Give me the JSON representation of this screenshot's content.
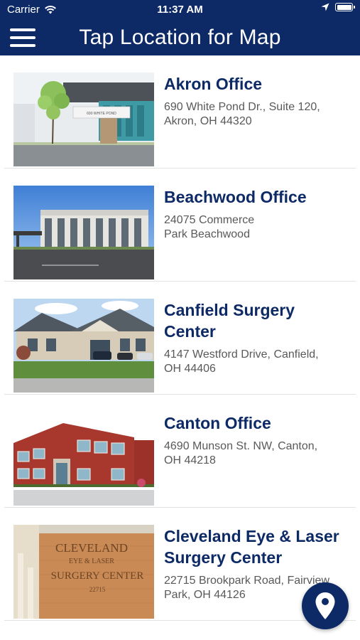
{
  "status_bar": {
    "carrier": "Carrier",
    "time": "11:37 AM",
    "icons": [
      "wifi-icon",
      "location-arrow-icon",
      "battery-icon"
    ]
  },
  "nav_bar": {
    "title": "Tap Location for Map",
    "menu_icon": "hamburger-menu-icon"
  },
  "locations": [
    {
      "name": "Akron Office",
      "address_line1": "690 White Pond Dr., Suite 120,",
      "address_line2": "Akron, OH 44320",
      "photo_sign": "690 WHITE POND"
    },
    {
      "name": "Beachwood Office",
      "address_line1": "24075 Commerce",
      "address_line2": "Park Beachwood"
    },
    {
      "name": "Canfield Surgery Center",
      "address_line1": "4147 Westford Drive, Canfield,",
      "address_line2": "OH 44406"
    },
    {
      "name": "Canton Office",
      "address_line1": "4690 Munson St. NW, Canton,",
      "address_line2": "OH 44218"
    },
    {
      "name": "Cleveland Eye & Laser Surgery Center",
      "address_line1": "22715 Brookpark Road, Fairview",
      "address_line2": "Park, OH 44126",
      "photo_sign_lines": [
        "CLEVELAND",
        "EYE & LASER",
        "SURGERY CENTER",
        "22715"
      ]
    }
  ],
  "map_button": {
    "icon": "map-pin-icon"
  },
  "colors": {
    "brand_navy": "#0d2a66",
    "address_gray": "#595959",
    "divider": "#e2e2e2"
  }
}
